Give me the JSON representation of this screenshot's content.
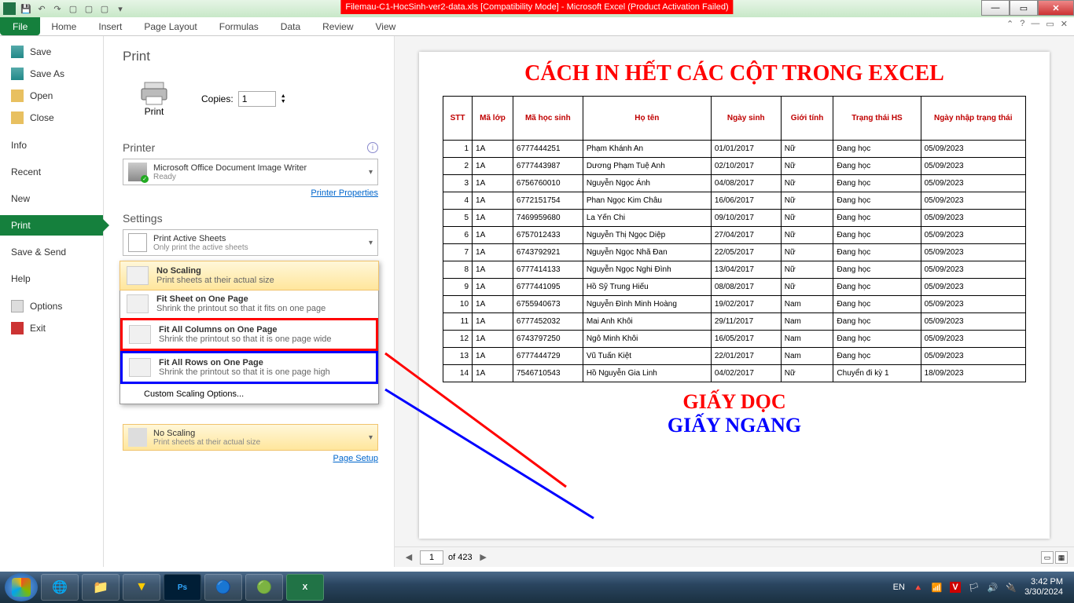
{
  "window": {
    "title": "Filemau-C1-HocSinh-ver2-data.xls  [Compatibility Mode]  -  Microsoft Excel (Product Activation Failed)"
  },
  "ribbon": {
    "file": "File",
    "tabs": [
      "Home",
      "Insert",
      "Page Layout",
      "Formulas",
      "Data",
      "Review",
      "View"
    ]
  },
  "nav": {
    "save": "Save",
    "save_as": "Save As",
    "open": "Open",
    "close": "Close",
    "info": "Info",
    "recent": "Recent",
    "new": "New",
    "print": "Print",
    "save_send": "Save & Send",
    "help": "Help",
    "options": "Options",
    "exit": "Exit"
  },
  "print": {
    "header": "Print",
    "btn": "Print",
    "copies_label": "Copies:",
    "copies_value": "1",
    "printer_header": "Printer",
    "printer_name": "Microsoft Office Document Image Writer",
    "printer_status": "Ready",
    "printer_props": "Printer Properties",
    "settings_header": "Settings",
    "active_sheets_title": "Print Active Sheets",
    "active_sheets_sub": "Only print the active sheets",
    "scaling": {
      "no_scaling": "No Scaling",
      "no_scaling_sub": "Print sheets at their actual size",
      "fit_sheet": "Fit Sheet on One Page",
      "fit_sheet_sub": "Shrink the printout so that it fits on one page",
      "fit_cols": "Fit All Columns on One Page",
      "fit_cols_sub": "Shrink the printout so that it is one page wide",
      "fit_rows": "Fit All Rows on One Page",
      "fit_rows_sub": "Shrink the printout so that it is one page high",
      "custom": "Custom Scaling Options..."
    },
    "current_scaling": "No Scaling",
    "current_scaling_sub": "Print sheets at their actual size",
    "page_setup": "Page Setup"
  },
  "preview": {
    "title": "CÁCH IN HẾT CÁC CỘT TRONG EXCEL",
    "text_red": "GIẤY DỌC",
    "text_blue": "GIẤY NGANG",
    "headers": [
      "STT",
      "Mã lớp",
      "Mã học sinh",
      "Họ tên",
      "Ngày sinh",
      "Giới tính",
      "Trạng thái HS",
      "Ngày nhập trạng thái"
    ],
    "rows": [
      [
        "1",
        "1A",
        "6777444251",
        "Phạm Khánh An",
        "01/01/2017",
        "Nữ",
        "Đang học",
        "05/09/2023"
      ],
      [
        "2",
        "1A",
        "6777443987",
        "Dương Phạm Tuệ Anh",
        "02/10/2017",
        "Nữ",
        "Đang học",
        "05/09/2023"
      ],
      [
        "3",
        "1A",
        "6756760010",
        "Nguyễn Ngọc Ánh",
        "04/08/2017",
        "Nữ",
        "Đang học",
        "05/09/2023"
      ],
      [
        "4",
        "1A",
        "6772151754",
        "Phan Ngọc Kim Châu",
        "16/06/2017",
        "Nữ",
        "Đang học",
        "05/09/2023"
      ],
      [
        "5",
        "1A",
        "7469959680",
        "La Yến Chi",
        "09/10/2017",
        "Nữ",
        "Đang học",
        "05/09/2023"
      ],
      [
        "6",
        "1A",
        "6757012433",
        "Nguyễn Thị Ngọc Diệp",
        "27/04/2017",
        "Nữ",
        "Đang học",
        "05/09/2023"
      ],
      [
        "7",
        "1A",
        "6743792921",
        "Nguyễn Ngọc Nhã Đan",
        "22/05/2017",
        "Nữ",
        "Đang học",
        "05/09/2023"
      ],
      [
        "8",
        "1A",
        "6777414133",
        "Nguyễn Ngọc Nghi Đình",
        "13/04/2017",
        "Nữ",
        "Đang học",
        "05/09/2023"
      ],
      [
        "9",
        "1A",
        "6777441095",
        "Hồ Sỹ Trung Hiếu",
        "08/08/2017",
        "Nữ",
        "Đang học",
        "05/09/2023"
      ],
      [
        "10",
        "1A",
        "6755940673",
        "Nguyễn Đình Minh Hoàng",
        "19/02/2017",
        "Nam",
        "Đang học",
        "05/09/2023"
      ],
      [
        "11",
        "1A",
        "6777452032",
        "Mai Anh Khôi",
        "29/11/2017",
        "Nam",
        "Đang học",
        "05/09/2023"
      ],
      [
        "12",
        "1A",
        "6743797250",
        "Ngô Minh Khôi",
        "16/05/2017",
        "Nam",
        "Đang học",
        "05/09/2023"
      ],
      [
        "13",
        "1A",
        "6777444729",
        "Vũ Tuấn Kiệt",
        "22/01/2017",
        "Nam",
        "Đang học",
        "05/09/2023"
      ],
      [
        "14",
        "1A",
        "7546710543",
        "Hồ Nguyễn Gia Linh",
        "04/02/2017",
        "Nữ",
        "Chuyển đi kỳ 1",
        "18/09/2023"
      ]
    ]
  },
  "nav_page": {
    "current": "1",
    "total": "of 423"
  },
  "taskbar": {
    "lang": "EN",
    "time": "3:42 PM",
    "date": "3/30/2024"
  }
}
